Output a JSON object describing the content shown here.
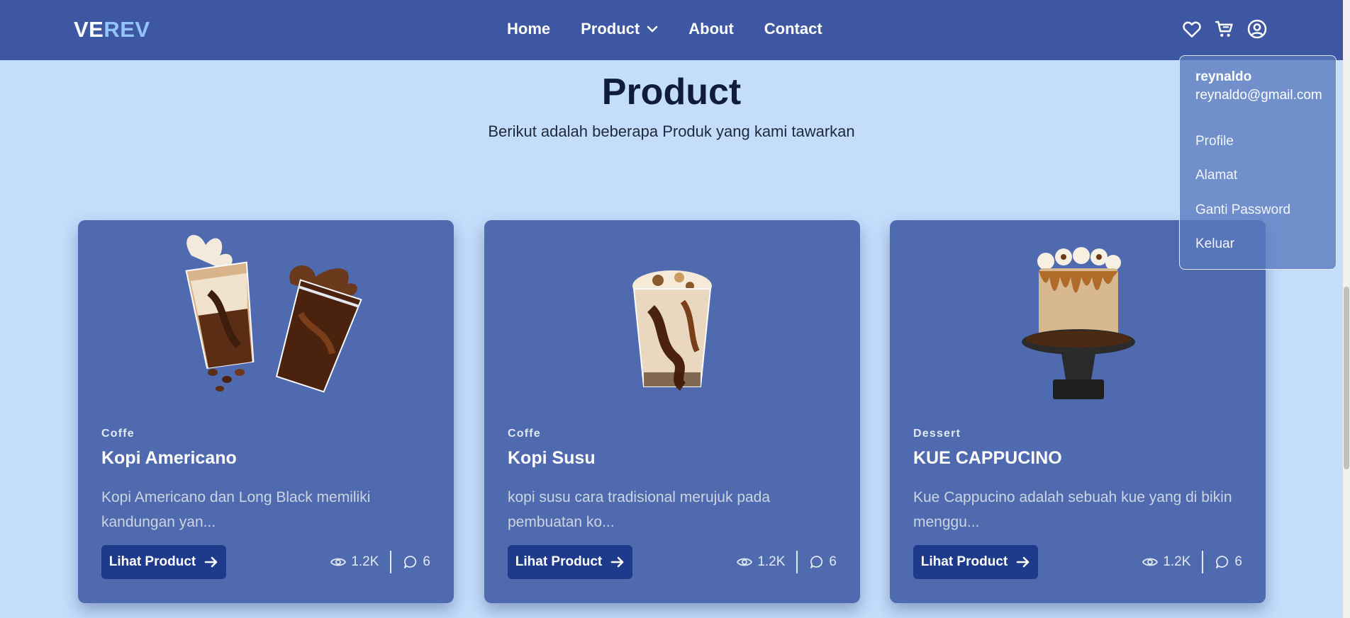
{
  "navbar": {
    "logo_part1": "VE",
    "logo_part2": "REV",
    "links": [
      {
        "label": "Home"
      },
      {
        "label": "Product"
      },
      {
        "label": "About"
      },
      {
        "label": "Contact"
      }
    ],
    "icons": [
      "heart-icon",
      "cart-icon",
      "user-circle-icon"
    ]
  },
  "hero": {
    "title": "Product",
    "subtitle": "Berikut adalah beberapa Produk yang kami tawarkan"
  },
  "products": [
    {
      "category": "Coffe",
      "title": "Kopi Americano",
      "description": "Kopi Americano dan Long Black memiliki kandungan yan...",
      "button_label": "Lihat Product",
      "views": "1.2K",
      "comments": "6"
    },
    {
      "category": "Coffe",
      "title": "Kopi Susu",
      "description": "kopi susu cara tradisional merujuk pada pembuatan ko...",
      "button_label": "Lihat Product",
      "views": "1.2K",
      "comments": "6"
    },
    {
      "category": "Dessert",
      "title": "KUE CAPPUCINO",
      "description": "Kue Cappucino adalah sebuah kue yang di bikin menggu...",
      "button_label": "Lihat Product",
      "views": "1.2K",
      "comments": "6"
    }
  ],
  "user_menu": {
    "name": "reynaldo",
    "email": "reynaldo@gmail.com",
    "items": [
      {
        "label": "Profile"
      },
      {
        "label": "Alamat"
      },
      {
        "label": "Ganti Password"
      },
      {
        "label": "Keluar"
      }
    ]
  },
  "colors": {
    "navbar": "#3d57a3",
    "page_background": "#c4ddfb",
    "card": "#4f6aae",
    "button": "#1e3a8a",
    "logo_accent": "#93c5fd"
  }
}
